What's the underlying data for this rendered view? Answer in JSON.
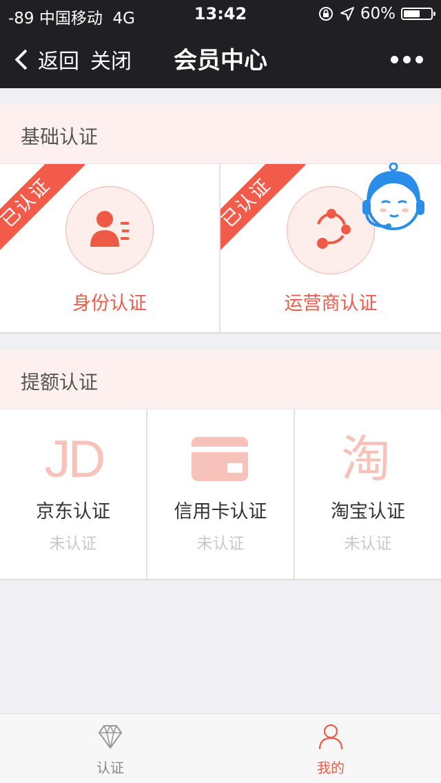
{
  "status_bar": {
    "signal_carrier": "-89 中国移动",
    "network": "4G",
    "time": "13:42",
    "battery": "60%",
    "battery_level": 0.6
  },
  "nav": {
    "back_label": "返回",
    "close_label": "关闭",
    "title": "会员中心"
  },
  "basic_section": {
    "title": "基础认证",
    "items": [
      {
        "label": "身份认证",
        "ribbon": "已认证",
        "icon": "id-card-icon"
      },
      {
        "label": "运营商认证",
        "ribbon": "已认证",
        "icon": "share-nodes-icon"
      }
    ]
  },
  "limit_section": {
    "title": "提额认证",
    "items": [
      {
        "label": "京东认证",
        "status": "未认证",
        "icon_text": "JD"
      },
      {
        "label": "信用卡认证",
        "status": "未认证",
        "icon": "credit-card-icon"
      },
      {
        "label": "淘宝认证",
        "status": "未认证",
        "icon_text": "淘"
      }
    ]
  },
  "tabbar": {
    "tabs": [
      {
        "label": "认证",
        "icon": "diamond-icon",
        "active": false
      },
      {
        "label": "我的",
        "icon": "user-icon",
        "active": true
      }
    ]
  },
  "colors": {
    "accent": "#eb5c4a",
    "ribbon": "#f25a4a",
    "header_bg": "#1f1f24",
    "service_blue": "#2a8de8"
  }
}
